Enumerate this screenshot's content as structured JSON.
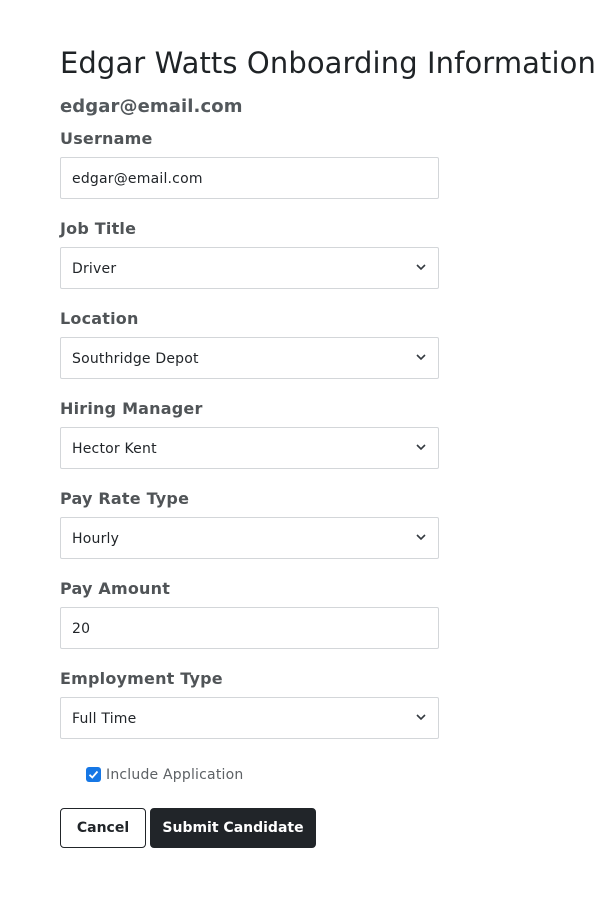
{
  "page": {
    "title": "Edgar Watts Onboarding Information",
    "email": "edgar@email.com"
  },
  "fields": {
    "username": {
      "label": "Username",
      "value": "edgar@email.com"
    },
    "job_title": {
      "label": "Job Title",
      "value": "Driver"
    },
    "location": {
      "label": "Location",
      "value": "Southridge Depot"
    },
    "hiring_manager": {
      "label": "Hiring Manager",
      "value": "Hector Kent"
    },
    "pay_rate_type": {
      "label": "Pay Rate Type",
      "value": "Hourly"
    },
    "pay_amount": {
      "label": "Pay Amount",
      "value": "20"
    },
    "employment_type": {
      "label": "Employment Type",
      "value": "Full Time"
    }
  },
  "include_application": {
    "label": "Include Application",
    "checked": true
  },
  "actions": {
    "cancel_label": "Cancel",
    "submit_label": "Submit Candidate"
  },
  "icons": {
    "select": "chevron-down-icon",
    "checkbox": "check-icon"
  },
  "colors": {
    "primary_button": "#212529",
    "checkbox_accent": "#1677e5",
    "field_border": "#d3d6d9"
  }
}
